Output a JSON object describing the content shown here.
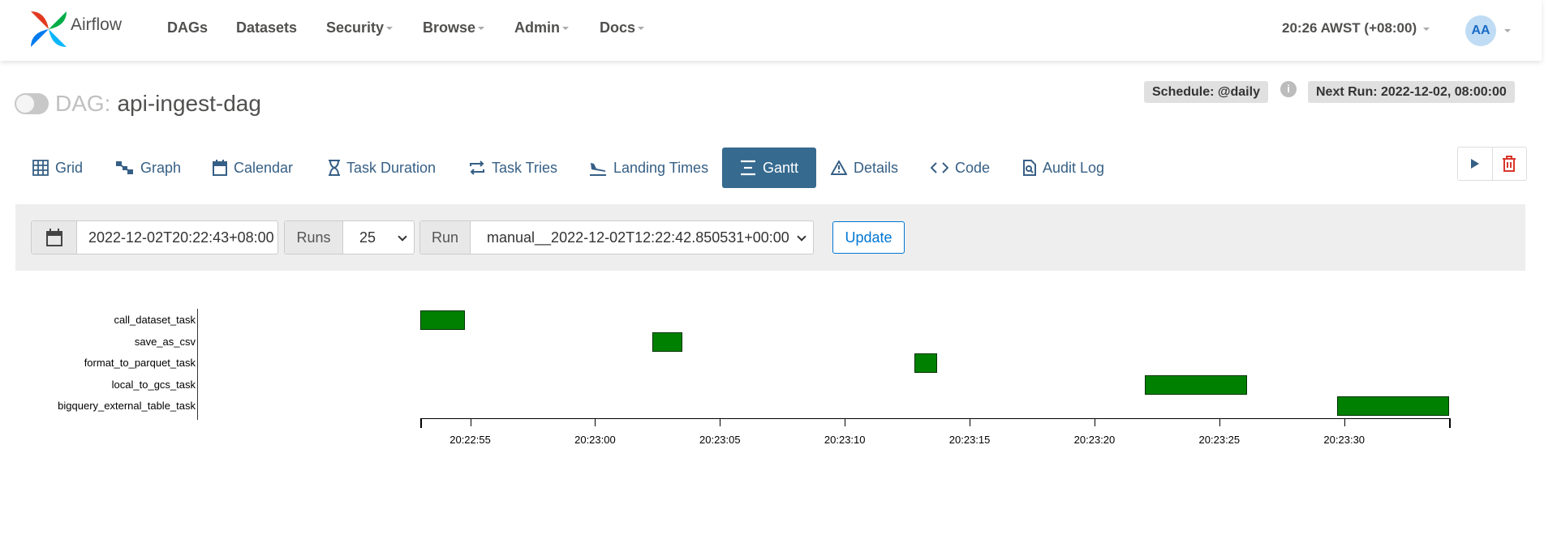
{
  "nav": {
    "brand": "Airflow",
    "items": [
      {
        "label": "DAGs",
        "caret": false
      },
      {
        "label": "Datasets",
        "caret": false
      },
      {
        "label": "Security",
        "caret": true
      },
      {
        "label": "Browse",
        "caret": true
      },
      {
        "label": "Admin",
        "caret": true
      },
      {
        "label": "Docs",
        "caret": true
      }
    ],
    "clock": "20:26 AWST (+08:00)",
    "avatar": "AA"
  },
  "dag": {
    "prefix": "DAG:",
    "id": "api-ingest-dag",
    "schedule": "Schedule: @daily",
    "next_run": "Next Run: 2022-12-02, 08:00:00",
    "info_icon": "i"
  },
  "tabs": [
    {
      "label": "Grid",
      "icon": "grid-icon"
    },
    {
      "label": "Graph",
      "icon": "graph-icon"
    },
    {
      "label": "Calendar",
      "icon": "calendar-icon"
    },
    {
      "label": "Task Duration",
      "icon": "hourglass-icon"
    },
    {
      "label": "Task Tries",
      "icon": "retry-icon"
    },
    {
      "label": "Landing Times",
      "icon": "plane-landing-icon"
    },
    {
      "label": "Gantt",
      "icon": "gantt-icon",
      "active": true
    },
    {
      "label": "Details",
      "icon": "warning-triangle-icon"
    },
    {
      "label": "Code",
      "icon": "code-icon"
    },
    {
      "label": "Audit Log",
      "icon": "file-search-icon"
    }
  ],
  "filters": {
    "date_value": "2022-12-02T20:22:43+08:00",
    "runs_label": "Runs",
    "runs_value": "25",
    "run_label": "Run",
    "run_value": "manual__2022-12-02T12:22:42.850531+00:00",
    "update_label": "Update"
  },
  "chart_data": {
    "type": "gantt",
    "tasks": [
      {
        "name": "call_dataset_task",
        "start": "20:22:53.0",
        "end": "20:22:54.8"
      },
      {
        "name": "save_as_csv",
        "start": "20:23:02.3",
        "end": "20:23:03.5"
      },
      {
        "name": "format_to_parquet_task",
        "start": "20:23:12.8",
        "end": "20:23:13.7"
      },
      {
        "name": "local_to_gcs_task",
        "start": "20:23:22.0",
        "end": "20:23:26.1"
      },
      {
        "name": "bigquery_external_table_task",
        "start": "20:23:29.7",
        "end": "20:23:34.2"
      }
    ],
    "x_ticks": [
      "20:22:55",
      "20:23:00",
      "20:23:05",
      "20:23:10",
      "20:23:15",
      "20:23:20",
      "20:23:25",
      "20:23:30"
    ],
    "x_range": [
      "20:22:53.0",
      "20:23:34.2"
    ],
    "bar_color": "#008000"
  }
}
